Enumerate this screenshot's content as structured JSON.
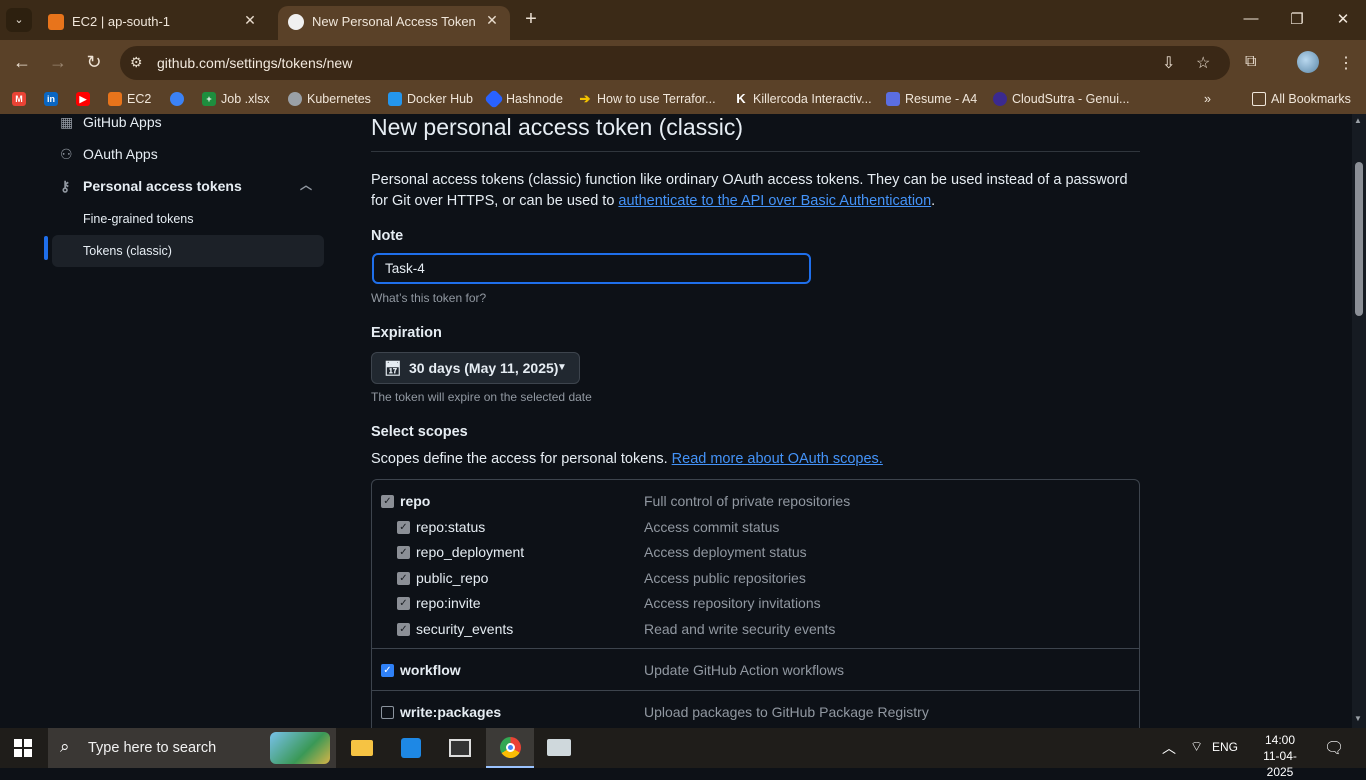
{
  "browser": {
    "tabs": [
      {
        "title": "EC2 | ap-south-1",
        "favicon": "aws-icon"
      },
      {
        "title": "New Personal Access Token (Cla",
        "favicon": "github-icon"
      }
    ],
    "url": "github.com/settings/tokens/new",
    "bookmarks": [
      {
        "label": "",
        "icon": "gmail-icon",
        "color": "#ea4335"
      },
      {
        "label": "",
        "icon": "linkedin-icon",
        "color": "#0a66c2"
      },
      {
        "label": "",
        "icon": "youtube-icon",
        "color": "#ff0000"
      },
      {
        "label": "EC2",
        "icon": "aws-icon",
        "color": "#e8741b"
      },
      {
        "label": "",
        "icon": "bookmark-app-icon",
        "color": "#3b82f6"
      },
      {
        "label": "Job .xlsx",
        "icon": "sheets-icon",
        "color": "#1e8e3e"
      },
      {
        "label": "Kubernetes",
        "icon": "globe-icon",
        "color": "#9aa0a6"
      },
      {
        "label": "Docker Hub",
        "icon": "docker-icon",
        "color": "#2496ed"
      },
      {
        "label": "Hashnode",
        "icon": "hashnode-icon",
        "color": "#2962ff"
      },
      {
        "label": "How to use Terrafor...",
        "icon": "arrow-icon",
        "color": "#f2c200"
      },
      {
        "label": "Killercoda Interactiv...",
        "icon": "killercoda-icon",
        "color": "#111111"
      },
      {
        "label": "Resume - A4",
        "icon": "resume-icon",
        "color": "#5b6ee1"
      },
      {
        "label": "CloudSutra - Genui...",
        "icon": "cloudsutra-icon",
        "color": "#3b2a8f"
      }
    ],
    "all_bookmarks": "All Bookmarks"
  },
  "sidebar": {
    "items": [
      {
        "label": "GitHub Apps"
      },
      {
        "label": "OAuth Apps"
      },
      {
        "label": "Personal access tokens"
      }
    ],
    "sub_items": [
      {
        "label": "Fine-grained tokens"
      },
      {
        "label": "Tokens (classic)"
      }
    ]
  },
  "main": {
    "title": "New personal access token (classic)",
    "description_text": "Personal access tokens (classic) function like ordinary OAuth access tokens. They can be used instead of a password for Git over HTTPS, or can be used to ",
    "description_link": "authenticate to the API over Basic Authentication",
    "description_end": ".",
    "note_label": "Note",
    "note_value": "Task-4",
    "note_hint": "What’s this token for?",
    "expiration_label": "Expiration",
    "expiration_value": "30 days (May 11, 2025)",
    "expiration_hint": "The token will expire on the selected date",
    "scopes_label": "Select scopes",
    "scopes_text": "Scopes define the access for personal tokens. ",
    "scopes_link": "Read more about OAuth scopes.",
    "scopes": [
      {
        "name": "repo",
        "desc": "Full control of private repositories",
        "checked": true,
        "parent": true
      },
      {
        "name": "repo:status",
        "desc": "Access commit status",
        "checked": true,
        "parent": false
      },
      {
        "name": "repo_deployment",
        "desc": "Access deployment status",
        "checked": true,
        "parent": false
      },
      {
        "name": "public_repo",
        "desc": "Access public repositories",
        "checked": true,
        "parent": false
      },
      {
        "name": "repo:invite",
        "desc": "Access repository invitations",
        "checked": true,
        "parent": false
      },
      {
        "name": "security_events",
        "desc": "Read and write security events",
        "checked": true,
        "parent": false
      },
      {
        "name": "workflow",
        "desc": "Update GitHub Action workflows",
        "checked": true,
        "parent": true
      },
      {
        "name": "write:packages",
        "desc": "Upload packages to GitHub Package Registry",
        "checked": false,
        "parent": true
      }
    ]
  },
  "taskbar": {
    "search_placeholder": "Type here to search",
    "language": "ENG",
    "time": "14:00",
    "date": "11-04-2025"
  }
}
